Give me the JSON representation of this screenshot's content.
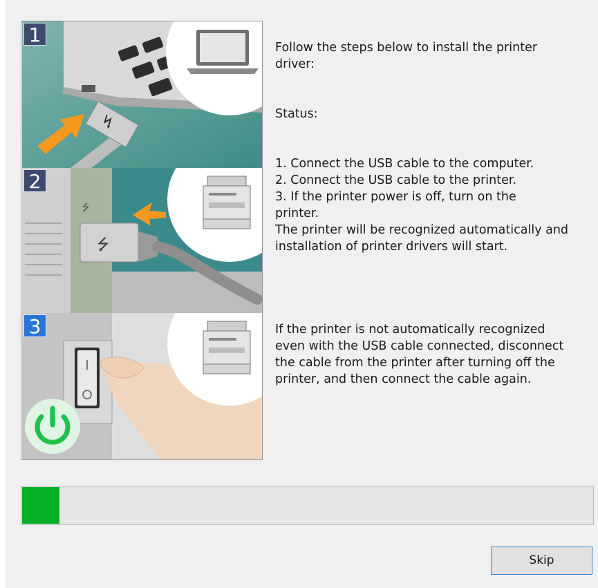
{
  "illustration": {
    "steps": [
      {
        "number": "1",
        "depicts": "laptop-usb-cable"
      },
      {
        "number": "2",
        "depicts": "printer-usb-port"
      },
      {
        "number": "3",
        "depicts": "printer-power-switch"
      }
    ]
  },
  "instructions": {
    "intro": "Follow the steps below to install the printer\ndriver:",
    "status_label": "Status:",
    "steps_text": "1. Connect the USB cable to the computer.\n2. Connect the USB cable to the printer.\n3. If the printer power is off, turn on the\nprinter.\nThe printer will be recognized automatically and\ninstallation of printer drivers will start.",
    "troubleshoot": "If the printer is not automatically recognized\neven with the USB cable connected, disconnect\nthe cable from the printer after turning off the\nprinter, and then connect the cable again."
  },
  "progress": {
    "value_fraction": 0.065
  },
  "buttons": {
    "skip_label": "Skip"
  },
  "colors": {
    "progress_fill": "#06b025",
    "badge_dark": "#3e4a6e",
    "badge_active": "#2a76d6",
    "arrow": "#f59a1e",
    "power_green": "#1ec24a"
  }
}
